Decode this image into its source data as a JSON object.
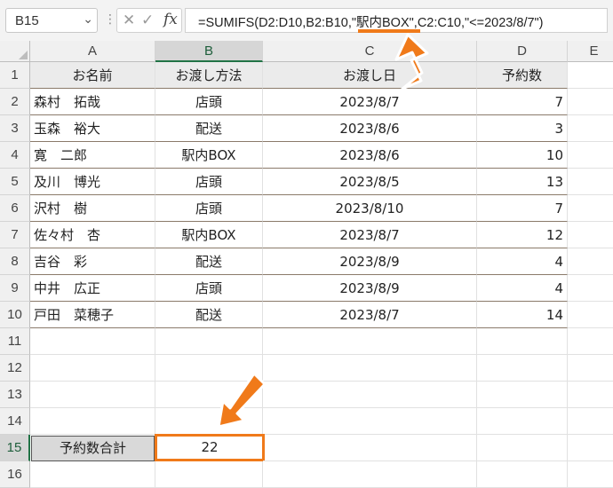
{
  "formula_bar": {
    "name_box": "B15",
    "cancel_icon": "✕",
    "enter_icon": "✓",
    "fx_label": "fx",
    "formula_prefix": "=SUMIFS(D2:D10,B2:B10,\"",
    "formula_highlight": "駅内BOX",
    "formula_suffix": "\",C2:C10,\"<=2023/8/7\")"
  },
  "columns": [
    "A",
    "B",
    "C",
    "D",
    "E"
  ],
  "rows": [
    "1",
    "2",
    "3",
    "4",
    "5",
    "6",
    "7",
    "8",
    "9",
    "10",
    "11",
    "12",
    "13",
    "14",
    "15",
    "16"
  ],
  "table": {
    "headers": [
      "お名前",
      "お渡し方法",
      "お渡し日",
      "予約数"
    ],
    "rows": [
      [
        "森村　拓哉",
        "店頭",
        "2023/8/7",
        "7"
      ],
      [
        "玉森　裕大",
        "配送",
        "2023/8/6",
        "3"
      ],
      [
        "寛　二郎",
        "駅内BOX",
        "2023/8/6",
        "10"
      ],
      [
        "及川　博光",
        "店頭",
        "2023/8/5",
        "13"
      ],
      [
        "沢村　樹",
        "店頭",
        "2023/8/10",
        "7"
      ],
      [
        "佐々村　杏",
        "駅内BOX",
        "2023/8/7",
        "12"
      ],
      [
        "吉谷　彩",
        "配送",
        "2023/8/9",
        "4"
      ],
      [
        "中井　広正",
        "店頭",
        "2023/8/9",
        "4"
      ],
      [
        "戸田　菜穂子",
        "配送",
        "2023/8/7",
        "14"
      ]
    ]
  },
  "summary": {
    "label": "予約数合計",
    "value": "22"
  },
  "colors": {
    "accent_orange": "#f07a1a",
    "excel_green": "#217346"
  }
}
